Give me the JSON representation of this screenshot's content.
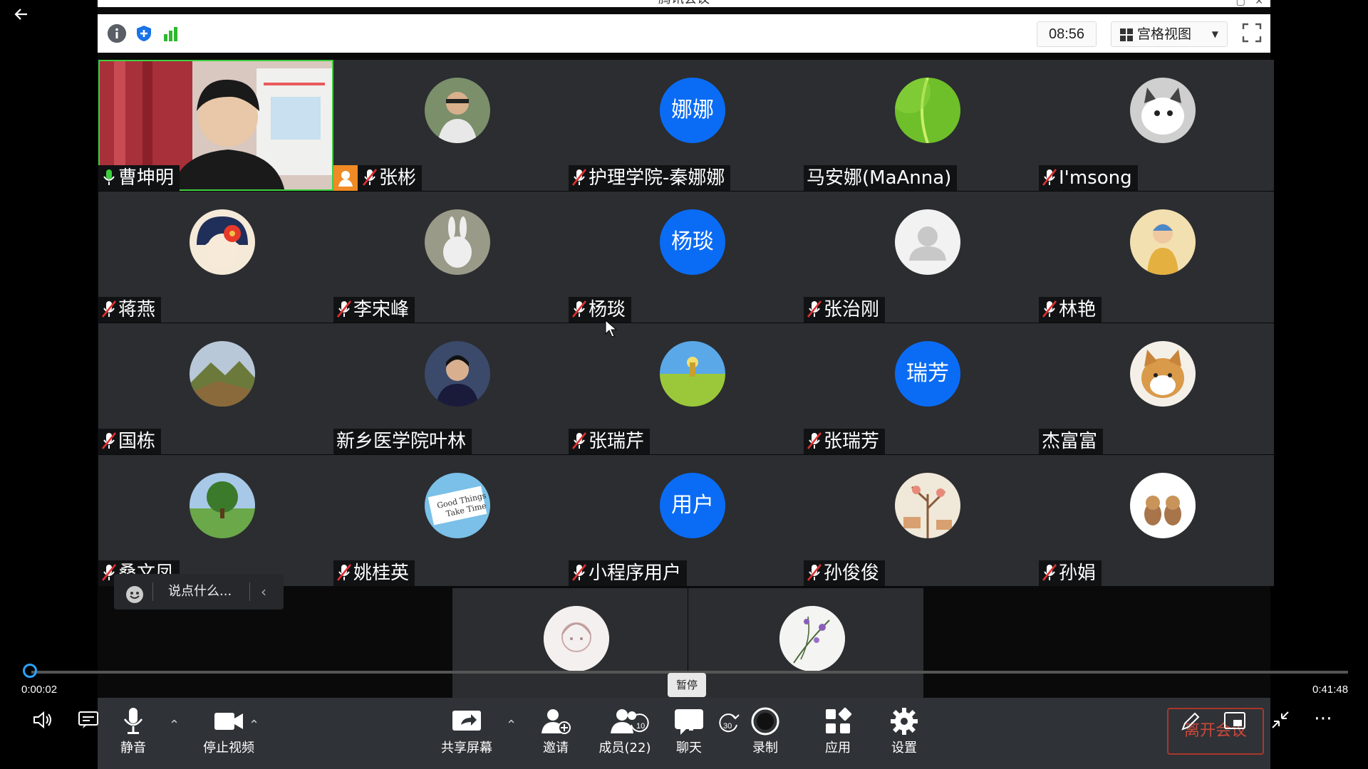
{
  "window": {
    "title": "腾讯会议"
  },
  "top_toolbar": {
    "timer": "08:56",
    "view_label": "宫格视图"
  },
  "participants": [
    {
      "name": "曹坤明",
      "avatar": "video",
      "mic": "on",
      "sharing": false
    },
    {
      "name": "张彬",
      "avatar": "photo",
      "mic": "muted",
      "sharing": true
    },
    {
      "name": "护理学院-秦娜娜",
      "avatar_text": "娜娜",
      "mic": "muted"
    },
    {
      "name": "马安娜(MaAnna)",
      "avatar": "leaf",
      "mic": "none"
    },
    {
      "name": "I'msong",
      "avatar": "cat",
      "mic": "muted"
    },
    {
      "name": "蒋燕",
      "avatar": "girl-flower",
      "mic": "muted"
    },
    {
      "name": "李宋峰",
      "avatar": "rabbit",
      "mic": "muted"
    },
    {
      "name": "杨琰",
      "avatar_text": "杨琰",
      "mic": "muted"
    },
    {
      "name": "张治刚",
      "avatar": "default",
      "mic": "muted"
    },
    {
      "name": "林艳",
      "avatar": "child",
      "mic": "muted"
    },
    {
      "name": "国栋",
      "avatar": "mountain",
      "mic": "muted"
    },
    {
      "name": "新乡医学院叶林",
      "avatar": "person",
      "mic": "none"
    },
    {
      "name": "张瑞芹",
      "avatar": "field",
      "mic": "muted"
    },
    {
      "name": "张瑞芳",
      "avatar_text": "瑞芳",
      "mic": "muted"
    },
    {
      "name": "杰富富",
      "avatar": "shiba",
      "mic": "none"
    },
    {
      "name": "桑文凤",
      "avatar": "tree",
      "mic": "muted"
    },
    {
      "name": "姚桂英",
      "avatar": "good-things",
      "mic": "muted"
    },
    {
      "name": "小程序用户",
      "avatar_text": "用户",
      "mic": "muted"
    },
    {
      "name": "孙俊俊",
      "avatar": "painting",
      "mic": "muted"
    },
    {
      "name": "孙娟",
      "avatar": "cartoon",
      "mic": "muted"
    }
  ],
  "good_things_text": [
    "Good Things",
    "Take Time"
  ],
  "chat_placeholder": "说点什么...",
  "player": {
    "current_time": "0:00:02",
    "total_time": "0:41:48",
    "progress": 0.0008,
    "pause_tooltip": "暂停",
    "rewind_seconds": "10",
    "forward_seconds": "30"
  },
  "bottom_toolbar": {
    "mute": "静音",
    "stop_video": "停止视频",
    "share_screen": "共享屏幕",
    "invite": "邀请",
    "members": "成员(22)",
    "chat": "聊天",
    "record": "录制",
    "apps": "应用",
    "settings": "设置",
    "leave": "离开会议"
  },
  "colors": {
    "accent_blue": "#0a6cf5",
    "tile_bg": "#2b2d30",
    "progress_knob": "#2ba3ff",
    "share_orange": "#f08a24"
  }
}
